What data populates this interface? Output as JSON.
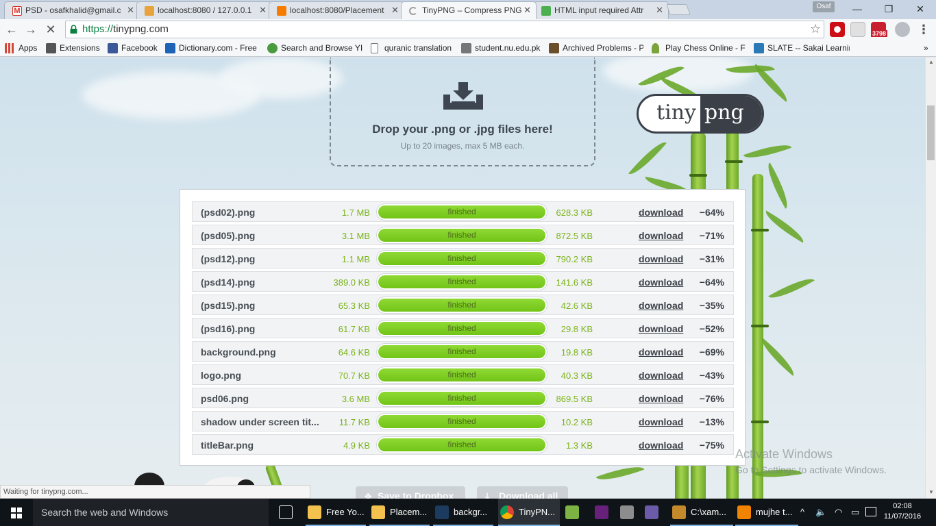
{
  "browser": {
    "tabs": [
      {
        "title": "PSD - osafkhalid@gmail.c",
        "favicon_color": "#d93025",
        "icon": "gmail-icon",
        "active": false
      },
      {
        "title": "localhost:8080 / 127.0.0.1",
        "favicon_color": "#e8a33d",
        "icon": "phpmyadmin-icon",
        "active": false
      },
      {
        "title": "localhost:8080/Placement",
        "favicon_color": "#f57c00",
        "icon": "xampp-icon",
        "active": false
      },
      {
        "title": "TinyPNG – Compress PNG",
        "favicon_color": "#9e9e9e",
        "icon": "loading-icon",
        "active": true
      },
      {
        "title": "HTML input required Attr",
        "favicon_color": "#4caf50",
        "icon": "w3schools-icon",
        "active": false
      }
    ],
    "profile_name": "Osaf",
    "url_scheme": "https://",
    "url_host": "tinypng.com",
    "gmail_badge": "3798",
    "bookmarks": [
      {
        "label": "Apps",
        "icon": "apps-grid-icon",
        "color": "#d34836"
      },
      {
        "label": "Extensions",
        "icon": "puzzle-icon",
        "color": "#555555"
      },
      {
        "label": "Facebook",
        "icon": "facebook-icon",
        "color": "#3b5998"
      },
      {
        "label": "Dictionary.com - Free",
        "icon": "dictionary-icon",
        "color": "#1d63b6"
      },
      {
        "label": "Search and Browse YII",
        "icon": "yii-icon",
        "color": "#4a9a3f"
      },
      {
        "label": "quranic translation",
        "icon": "page-icon",
        "color": "#ffffff"
      },
      {
        "label": "student.nu.edu.pk",
        "icon": "nu-icon",
        "color": "#777777"
      },
      {
        "label": "Archived Problems - P",
        "icon": "pe-icon",
        "color": "#6b4f2a"
      },
      {
        "label": "Play Chess Online - Fr",
        "icon": "chess-icon",
        "color": "#7aa33b"
      },
      {
        "label": "SLATE -- Sakai Learnin",
        "icon": "slate-icon",
        "color": "#2a7ab8"
      }
    ],
    "status_text": "Waiting for tinypng.com..."
  },
  "dropzone": {
    "title": "Drop your .png or .jpg files here!",
    "subtitle": "Up to 20 images, max 5 MB each."
  },
  "logo": {
    "left": "tiny",
    "right": "png"
  },
  "results": [
    {
      "name": "(psd02).png",
      "original": "1.7 MB",
      "status": "finished",
      "compressed": "628.3 KB",
      "action": "download",
      "saving": "−64%"
    },
    {
      "name": "(psd05).png",
      "original": "3.1 MB",
      "status": "finished",
      "compressed": "872.5 KB",
      "action": "download",
      "saving": "−71%"
    },
    {
      "name": "(psd12).png",
      "original": "1.1 MB",
      "status": "finished",
      "compressed": "790.2 KB",
      "action": "download",
      "saving": "−31%"
    },
    {
      "name": "(psd14).png",
      "original": "389.0 KB",
      "status": "finished",
      "compressed": "141.6 KB",
      "action": "download",
      "saving": "−64%"
    },
    {
      "name": "(psd15).png",
      "original": "65.3 KB",
      "status": "finished",
      "compressed": "42.6 KB",
      "action": "download",
      "saving": "−35%"
    },
    {
      "name": "(psd16).png",
      "original": "61.7 KB",
      "status": "finished",
      "compressed": "29.8 KB",
      "action": "download",
      "saving": "−52%"
    },
    {
      "name": "background.png",
      "original": "64.6 KB",
      "status": "finished",
      "compressed": "19.8 KB",
      "action": "download",
      "saving": "−69%"
    },
    {
      "name": "logo.png",
      "original": "70.7 KB",
      "status": "finished",
      "compressed": "40.3 KB",
      "action": "download",
      "saving": "−43%"
    },
    {
      "name": "psd06.png",
      "original": "3.6 MB",
      "status": "finished",
      "compressed": "869.5 KB",
      "action": "download",
      "saving": "−76%"
    },
    {
      "name": "shadow under screen tit...",
      "original": "11.7 KB",
      "status": "finished",
      "compressed": "10.2 KB",
      "action": "download",
      "saving": "−13%"
    },
    {
      "name": "titleBar.png",
      "original": "4.9 KB",
      "status": "finished",
      "compressed": "1.3 KB",
      "action": "download",
      "saving": "−75%"
    }
  ],
  "actions": {
    "dropbox": "Save to Dropbox",
    "download_all": "Download all"
  },
  "watermark": {
    "title": "Activate Windows",
    "subtitle": "Go to Settings to activate Windows."
  },
  "taskbar": {
    "search_placeholder": "Search the web and Windows",
    "items": [
      {
        "label": "",
        "icon": "task-view-icon",
        "color": "#ffffff"
      },
      {
        "label": "Free Yo...",
        "icon": "folder-icon",
        "color": "#f2c14e"
      },
      {
        "label": "Placem...",
        "icon": "folder-icon",
        "color": "#f2c14e"
      },
      {
        "label": "backgr...",
        "icon": "photoshop-icon",
        "color": "#1c3b5e"
      },
      {
        "label": "TinyPN...",
        "icon": "chrome-icon",
        "color": "#4caf50"
      },
      {
        "label": "",
        "icon": "android-studio-icon",
        "color": "#7cb342"
      },
      {
        "label": "",
        "icon": "visual-studio-icon",
        "color": "#68217a"
      },
      {
        "label": "",
        "icon": "gimp-icon",
        "color": "#8d8d8d"
      },
      {
        "label": "",
        "icon": "eclipse-icon",
        "color": "#6b5ba8"
      },
      {
        "label": "C:\\xam...",
        "icon": "cmd-icon",
        "color": "#c4892a"
      },
      {
        "label": "mujhe t...",
        "icon": "vlc-icon",
        "color": "#f08300"
      }
    ],
    "time": "02:08",
    "date": "11/07/2016"
  }
}
